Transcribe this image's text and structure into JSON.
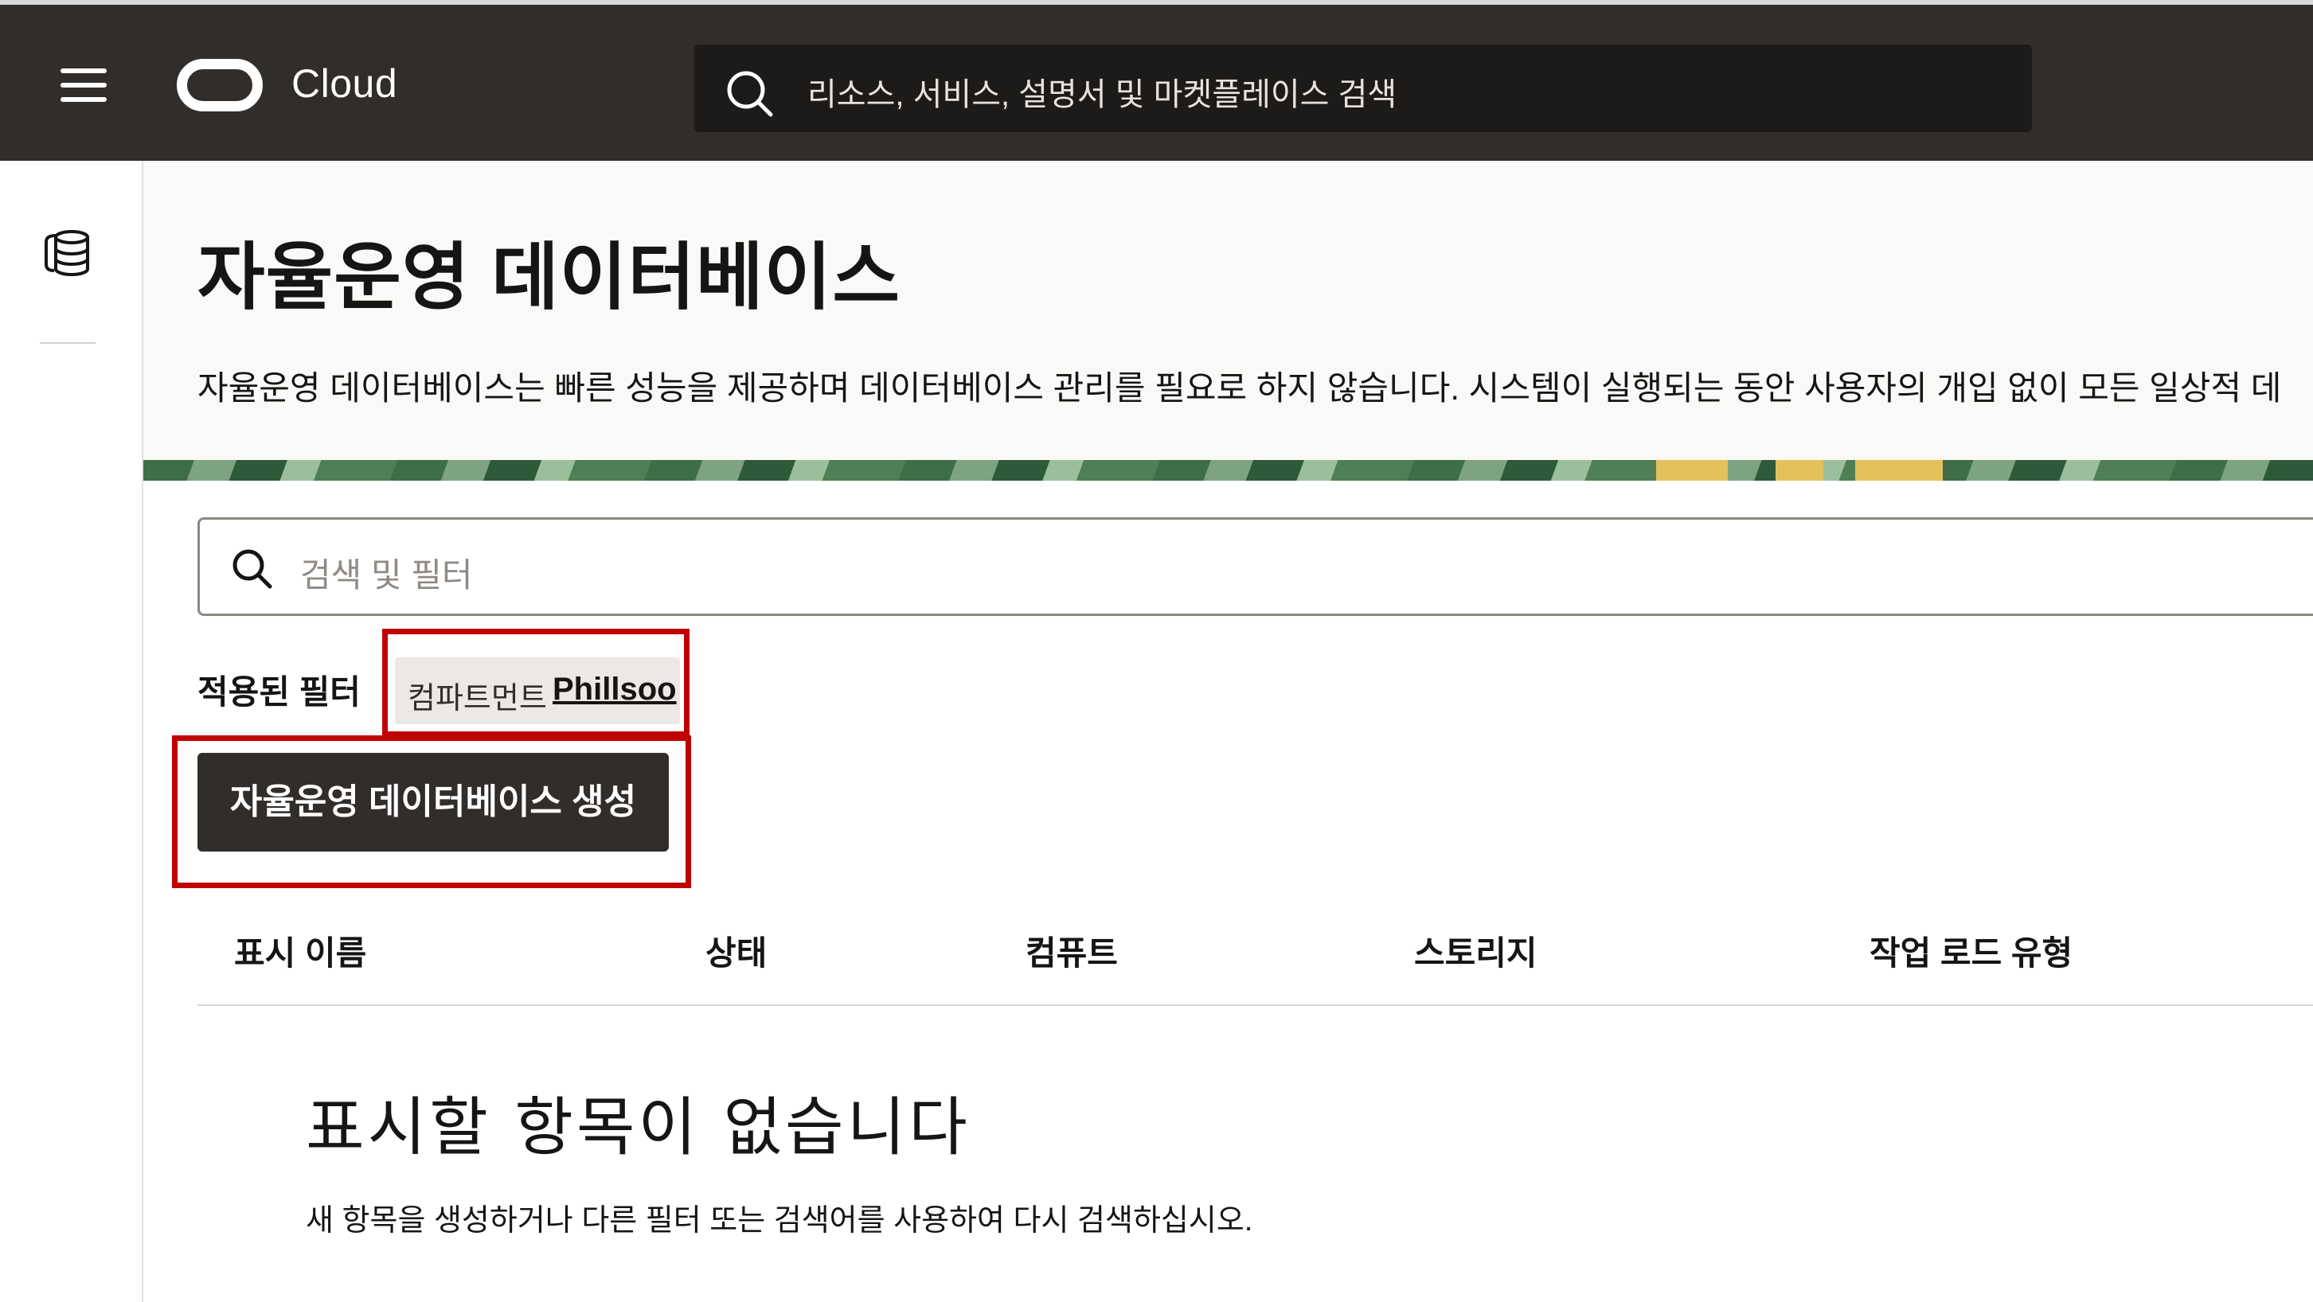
{
  "topbar": {
    "brand": "Cloud",
    "search_placeholder": "리소스, 서비스, 설명서 및 마켓플레이스 검색",
    "icons": [
      "menu-icon",
      "oracle-logo",
      "search-icon"
    ]
  },
  "sidebar": {
    "icons": [
      "database-icon"
    ]
  },
  "header": {
    "title": "자율운영 데이터베이스",
    "description": "자율운영 데이터베이스는 빠른 성능을 제공하며 데이터베이스 관리를 필요로 하지 않습니다. 시스템이 실행되는 동안 사용자의 개입 없이 모든 일상적 데"
  },
  "filter_search": {
    "placeholder": "검색 및 필터"
  },
  "applied_filters": {
    "label": "적용된 필터",
    "chips": [
      {
        "key": "컴파트먼트",
        "value": "Phillsoo"
      }
    ]
  },
  "actions": {
    "create_label": "자율운영 데이터베이스 생성"
  },
  "table": {
    "columns": [
      "표시 이름",
      "상태",
      "컴퓨트",
      "스토리지",
      "작업 로드 유형"
    ]
  },
  "empty_state": {
    "title": "표시할 항목이 없습니다",
    "description": "새 항목을 생성하거나 다른 필터 또는 검색어를 사용하여 다시 검색하십시오."
  },
  "colors": {
    "topbar_bg": "#312d2a",
    "header_bg": "#fbf9f8",
    "button_bg": "#312d2a",
    "highlight": "#c00000",
    "banner_green": "#3e6e47",
    "banner_gold": "#e4c15a"
  }
}
